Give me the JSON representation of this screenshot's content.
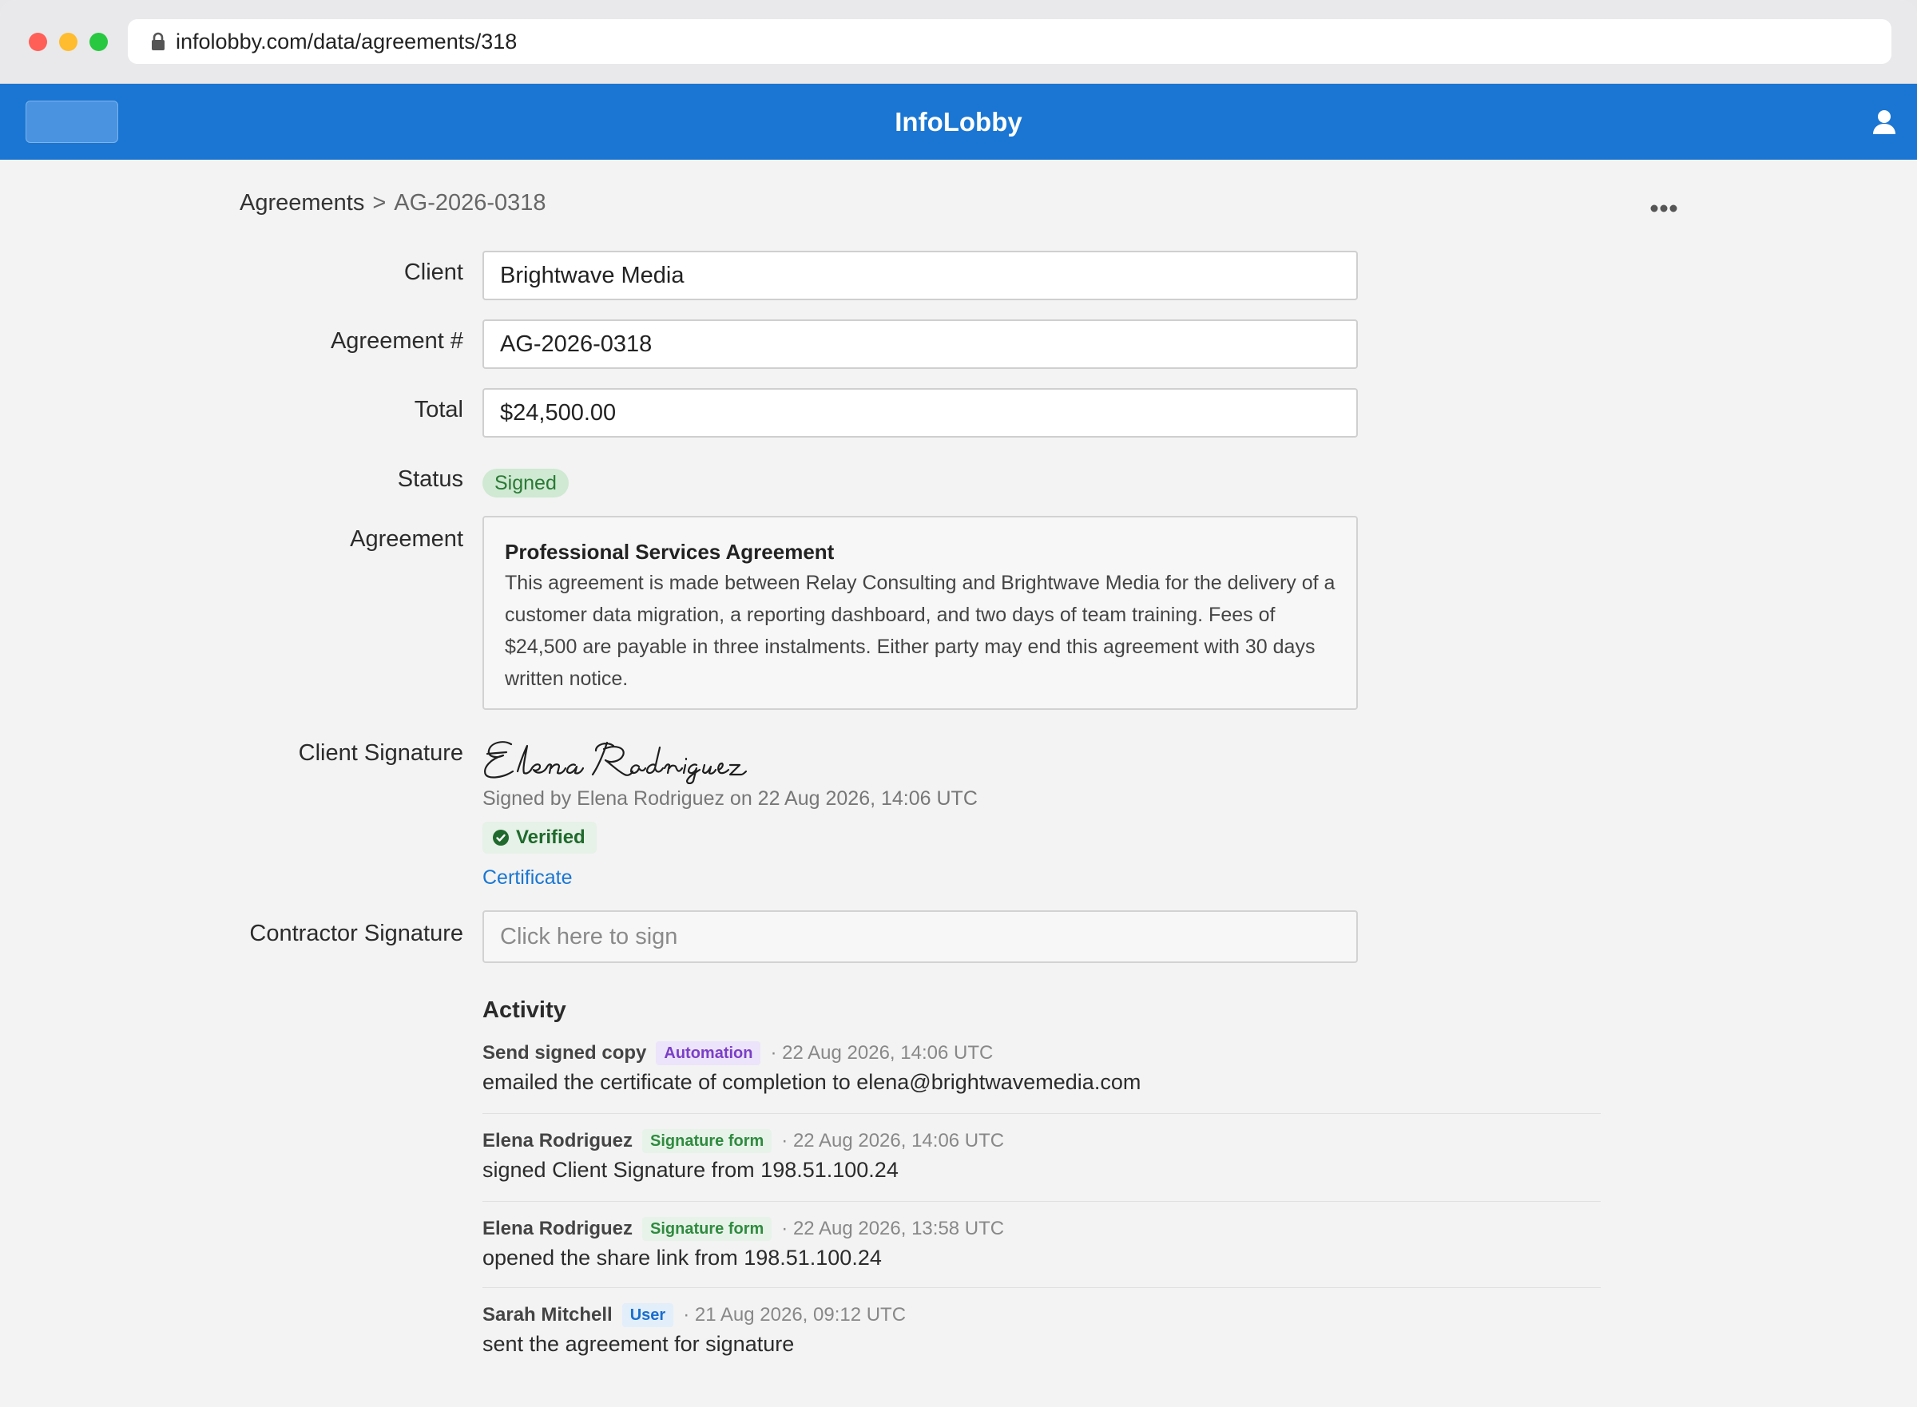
{
  "browser": {
    "url": "infolobby.com/data/agreements/318"
  },
  "app": {
    "title": "InfoLobby"
  },
  "breadcrumb": {
    "root": "Agreements",
    "separator": ">",
    "current": "AG-2026-0318"
  },
  "form": {
    "client_label": "Client",
    "client_value": "Brightwave Media",
    "agreement_no_label": "Agreement #",
    "agreement_no_value": "AG-2026-0318",
    "total_label": "Total",
    "total_value": "$24,500.00",
    "status_label": "Status",
    "status_value": "Signed",
    "agreement_label": "Agreement",
    "agreement_title": "Professional Services Agreement",
    "agreement_text": "This agreement is made between Relay Consulting and Brightwave Media for the delivery of a customer data migration, a reporting dashboard, and two days of team training. Fees of $24,500 are payable in three instalments. Either party may end this agreement with 30 days written notice.",
    "client_signature_label": "Client Signature",
    "client_signature_name": "Elena Rodriguez",
    "signed_by_text": "Signed by Elena Rodriguez on 22 Aug 2026, 14:06 UTC",
    "verified_label": "Verified",
    "certificate_link": "Certificate",
    "contractor_signature_label": "Contractor Signature",
    "contractor_signature_placeholder": "Click here to sign"
  },
  "activity": {
    "title": "Activity",
    "items": [
      {
        "actor": "Send signed copy",
        "tag": "Automation",
        "time": "· 22 Aug 2026, 14:06 UTC",
        "text": "emailed the certificate of completion to elena@brightwavemedia.com"
      },
      {
        "actor": "Elena Rodriguez",
        "tag": "Signature form",
        "time": "· 22 Aug 2026, 14:06 UTC",
        "text": "signed Client Signature from 198.51.100.24"
      },
      {
        "actor": "Elena Rodriguez",
        "tag": "Signature form",
        "time": "· 22 Aug 2026, 13:58 UTC",
        "text": "opened the share link from 198.51.100.24"
      },
      {
        "actor": "Sarah Mitchell",
        "tag": "User",
        "time": "· 21 Aug 2026, 09:12 UTC",
        "text": "sent the agreement for signature"
      }
    ]
  },
  "colors": {
    "brand": "#1a76d2",
    "signed_badge": "#cfe9d2",
    "link": "#1a76d2"
  },
  "icons": [
    "lock-icon",
    "user-icon",
    "more-icon",
    "check-circle-icon"
  ]
}
